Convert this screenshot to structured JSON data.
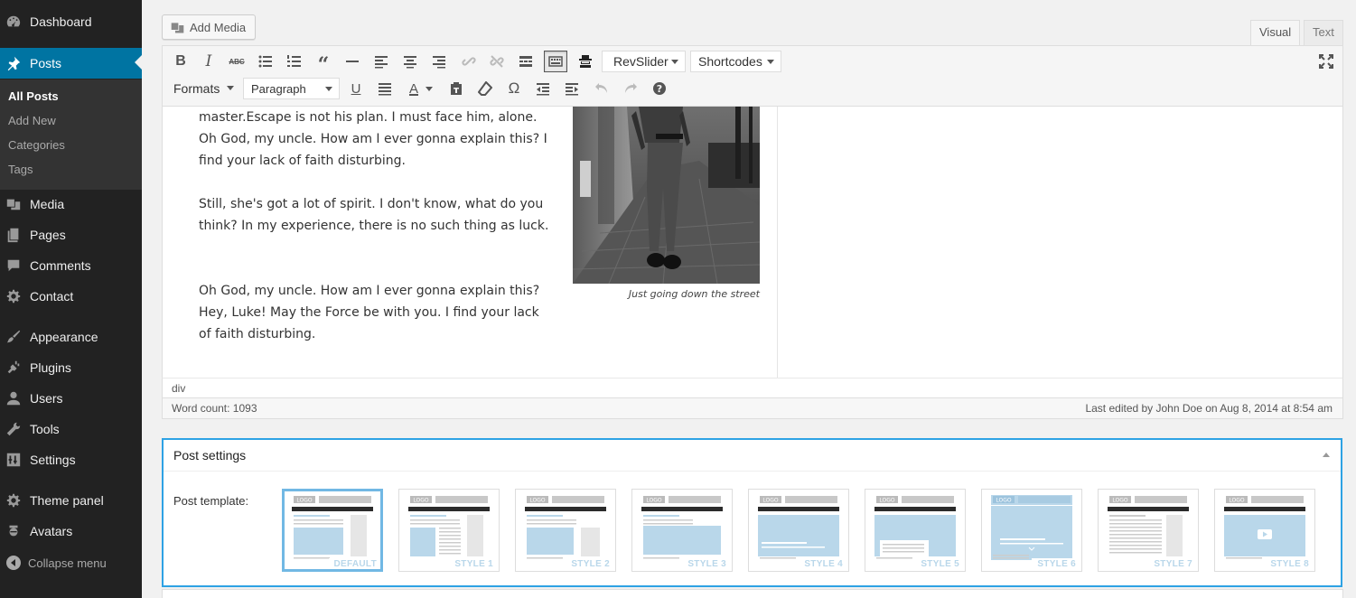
{
  "sidebar": {
    "dashboard": "Dashboard",
    "posts": "Posts",
    "sub": {
      "all_posts": "All Posts",
      "add_new": "Add New",
      "categories": "Categories",
      "tags": "Tags"
    },
    "media": "Media",
    "pages": "Pages",
    "comments": "Comments",
    "contact": "Contact",
    "appearance": "Appearance",
    "plugins": "Plugins",
    "users": "Users",
    "tools": "Tools",
    "settings": "Settings",
    "theme_panel": "Theme panel",
    "avatars": "Avatars",
    "collapse": "Collapse menu"
  },
  "editor": {
    "add_media": "Add Media",
    "tab_visual": "Visual",
    "tab_text": "Text",
    "toolbar": {
      "revslider": "RevSlider",
      "shortcodes": "Shortcodes",
      "formats": "Formats",
      "paragraph": "Paragraph"
    },
    "paragraphs": [
      "master.Escape is not his plan. I must face him, alone. Oh God, my uncle. How am I ever gonna explain this? I find your lack of faith disturbing.",
      "Still, she's got a lot of spirit. I don't know, what do you think? In my experience, there is no such thing as luck.",
      "Oh God, my uncle. How am I ever gonna explain this? Hey, Luke! May the Force be with you. I find your lack of faith disturbing."
    ],
    "caption": "Just going down the street",
    "path": "div",
    "word_count": "Word count: 1093",
    "last_edited": "Last edited by John Doe on Aug 8, 2014 at 8:54 am"
  },
  "post_settings": {
    "title": "Post settings",
    "template_label": "Post template:",
    "templates": [
      "DEFAULT",
      "STYLE 1",
      "STYLE 2",
      "STYLE 3",
      "STYLE 4",
      "STYLE 5",
      "STYLE 6",
      "STYLE 7",
      "STYLE 8"
    ],
    "logo_text": "LOGO"
  },
  "colors": {
    "admin_bar": "#222222",
    "active_blue": "#0074a2",
    "panel_highlight": "#2ea2e4",
    "thumb_blue": "#b9d7ea"
  }
}
